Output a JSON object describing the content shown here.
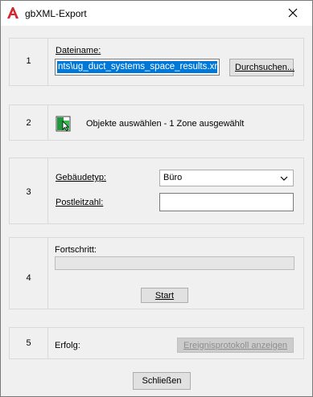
{
  "window": {
    "title": "gbXML-Export",
    "app_icon": "autodesk-a-icon",
    "close_icon": "close-icon"
  },
  "section1": {
    "number": "1",
    "filename_label": "Dateiname:",
    "filename_value": "nts\\ug_duct_systems_space_results.xml",
    "browse_button": "Durchsuchen..."
  },
  "section2": {
    "number": "2",
    "select_icon": "select-objects-icon",
    "select_label": "Objekte auswählen - 1 Zone ausgewählt"
  },
  "section3": {
    "number": "3",
    "building_type_label": "Gebäudetyp:",
    "building_type_value": "Büro",
    "postal_code_label": "Postleitzahl:",
    "postal_code_value": ""
  },
  "section4": {
    "number": "4",
    "progress_label": "Fortschritt:",
    "progress_value": 0,
    "start_button": "Start"
  },
  "section5": {
    "number": "5",
    "success_label": "Erfolg:",
    "log_button": "Ereignisprotokoll anzeigen"
  },
  "footer": {
    "close_button": "Schließen"
  },
  "colors": {
    "selection": "#0078d7",
    "autodesk_red": "#d7262e",
    "button_face": "#e1e1e1"
  }
}
